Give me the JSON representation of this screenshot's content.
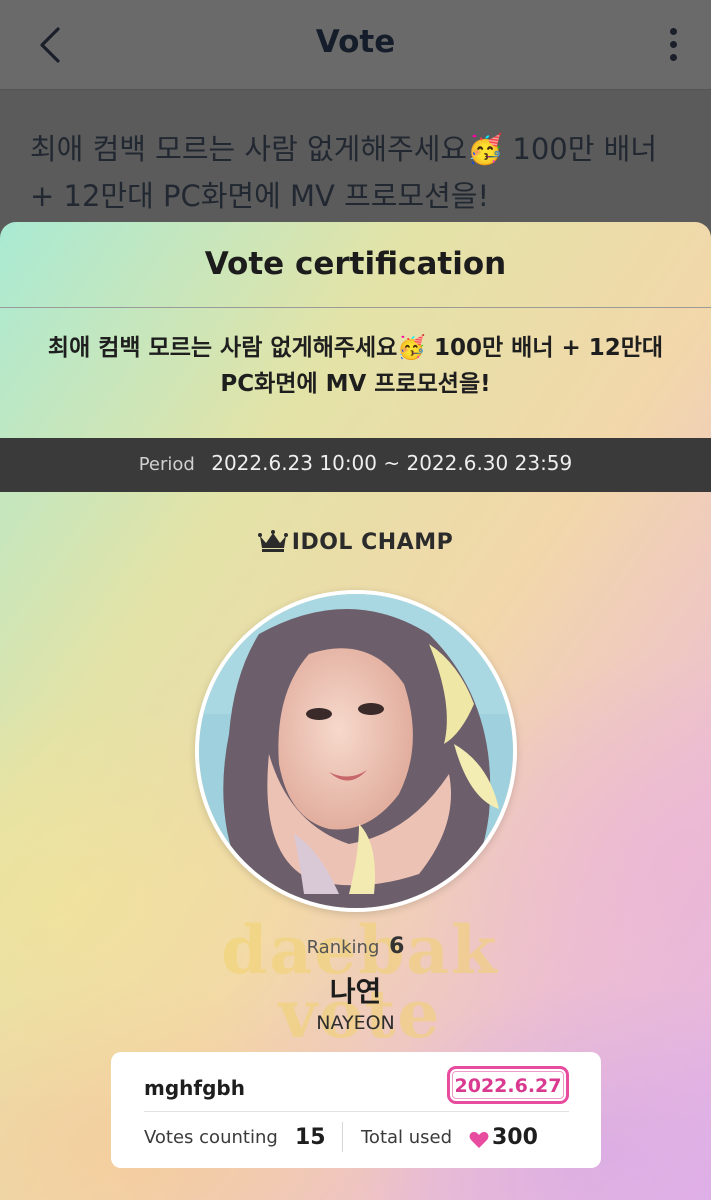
{
  "header": {
    "title": "Vote",
    "back_icon": "chevron-left-icon",
    "menu_icon": "more-vertical-icon"
  },
  "background": {
    "vote_title": "최애 컴백 모르는 사람 없게해주세요🥳 100만 배너 + 12만대 PC화면에 MV 프로모션을!"
  },
  "modal": {
    "title": "Vote certification",
    "subtitle": "최애 컴백 모르는 사람 없게해주세요🥳 100만 배너 + 12만대 PC화면에 MV 프로모션을!",
    "period_label": "Period",
    "period_value": "2022.6.23 10:00 ~ 2022.6.30 23:59",
    "brand": "IDOL CHAMP",
    "brand_icon": "crown-icon",
    "watermark": "daebak vote",
    "ranking_label": "Ranking",
    "ranking_value": "6",
    "name_korean": "나연",
    "name_english": "NAYEON"
  },
  "certificate": {
    "username": "mghfgbh",
    "date": "2022.6.27",
    "votes_label": "Votes counting",
    "votes_value": "15",
    "total_label": "Total used",
    "total_icon": "heart-icon",
    "total_value": "300"
  },
  "colors": {
    "accent_pink": "#e84c9f",
    "period_bar": "#3a3a3a",
    "dim_overlay": "#5b5b5b"
  }
}
